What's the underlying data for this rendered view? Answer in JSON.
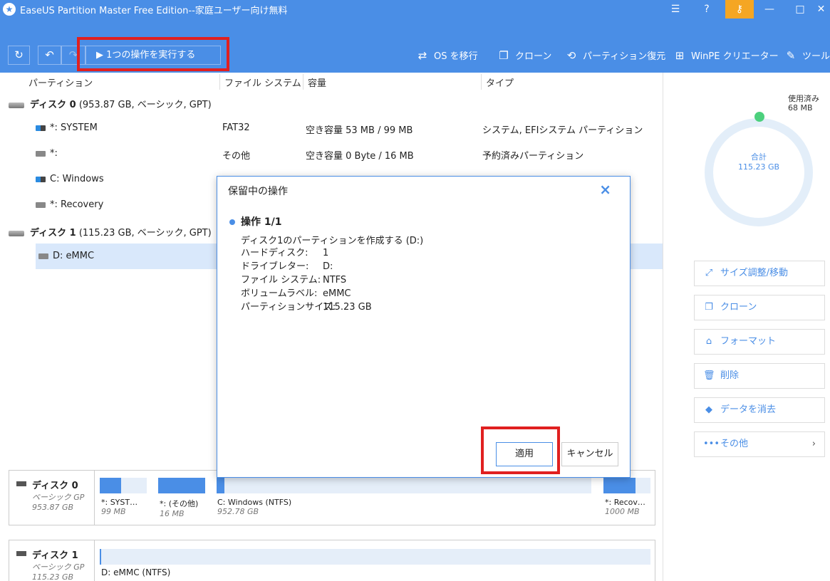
{
  "window": {
    "title": "EaseUS Partition Master Free Edition--家庭ユーザー向け無料",
    "app_icon": "star-icon",
    "controls": [
      "menu-icon",
      "help-icon",
      "key-icon",
      "minimize-icon",
      "maximize-icon",
      "close-icon"
    ],
    "accent_color": "#4a8ee6",
    "key_color": "#f5a623"
  },
  "toolbar": {
    "refresh_icon": "↻",
    "undo_icon": "↶",
    "redo_icon": "↷",
    "execute_label": "1つの操作を実行する",
    "items": [
      {
        "label": "OS を移行",
        "icon": "⇄"
      },
      {
        "label": "クローン",
        "icon": "❐"
      },
      {
        "label": "パーティション復元",
        "icon": "⟲"
      },
      {
        "label": "WinPE クリエーター",
        "icon": "⊞"
      },
      {
        "label": "ツール",
        "icon": "✎"
      }
    ]
  },
  "table": {
    "headers": [
      "パーティション",
      "ファイル システム",
      "容量",
      "タイプ"
    ],
    "disks": [
      {
        "name": "ディスク 0",
        "info": "(953.87 GB, ベーシック, GPT)",
        "partitions": [
          {
            "name": "*: SYSTEM",
            "fs": "FAT32",
            "capacity": "空き容量 53 MB / 99 MB",
            "type": "システム, EFIシステム パーティション"
          },
          {
            "name": "*:",
            "fs": "その他",
            "capacity": "空き容量 0 Byte / 16 MB",
            "type": "予約済みパーティション"
          },
          {
            "name": "C: Windows",
            "fs": "",
            "capacity": "",
            "type": ""
          },
          {
            "name": "*: Recovery",
            "fs": "",
            "capacity": "",
            "type": ""
          }
        ]
      },
      {
        "name": "ディスク 1",
        "info": "(115.23 GB, ベーシック, GPT)",
        "partitions": [
          {
            "name": "D: eMMC",
            "fs": "",
            "capacity": "",
            "type": ""
          }
        ]
      }
    ]
  },
  "map": [
    {
      "name": "ディスク 0",
      "kind": "ベーシック GP",
      "size": "953.87 GB",
      "segments": [
        {
          "label": "*: SYST…",
          "size": "99 MB",
          "fill": 0.46
        },
        {
          "label": "*: (その他)",
          "size": "16 MB",
          "fill": 1.0
        },
        {
          "label": "C: Windows (NTFS)",
          "size": "952.78 GB",
          "fill": 0.02
        },
        {
          "label": "*: Recov…",
          "size": "1000 MB",
          "fill": 0.68
        }
      ]
    },
    {
      "name": "ディスク 1",
      "kind": "ベーシック GP",
      "size": "115.23 GB",
      "segments": [
        {
          "label": "D: eMMC (NTFS)",
          "size": "",
          "fill": 0.0
        }
      ]
    }
  ],
  "usage": {
    "used_label": "使用済み",
    "used_value": "68 MB",
    "total_label": "合計",
    "total_value": "115.23 GB",
    "used_color": "#4cd07d"
  },
  "actions": [
    {
      "label": "サイズ調整/移動",
      "icon": "⤢"
    },
    {
      "label": "クローン",
      "icon": "❐"
    },
    {
      "label": "フォーマット",
      "icon": "⌂"
    },
    {
      "label": "削除",
      "icon": "🗑"
    },
    {
      "label": "データを消去",
      "icon": "◆"
    },
    {
      "label": "その他",
      "icon": "•••",
      "chevron": "›"
    }
  ],
  "dialog": {
    "title": "保留中の操作",
    "close_icon": "×",
    "op_heading": "操作 1/1",
    "op_description": "ディスク1のパーティションを作成する (D:)",
    "details": [
      {
        "key": "ハードディスク:",
        "value": "1"
      },
      {
        "key": "ドライブレター:",
        "value": "D:"
      },
      {
        "key": "ファイル システム:",
        "value": "NTFS"
      },
      {
        "key": "ボリュームラベル:",
        "value": "eMMC"
      },
      {
        "key": "パーティションサイズ:",
        "value": "115.23 GB"
      }
    ],
    "apply_label": "適用",
    "cancel_label": "キャンセル"
  }
}
